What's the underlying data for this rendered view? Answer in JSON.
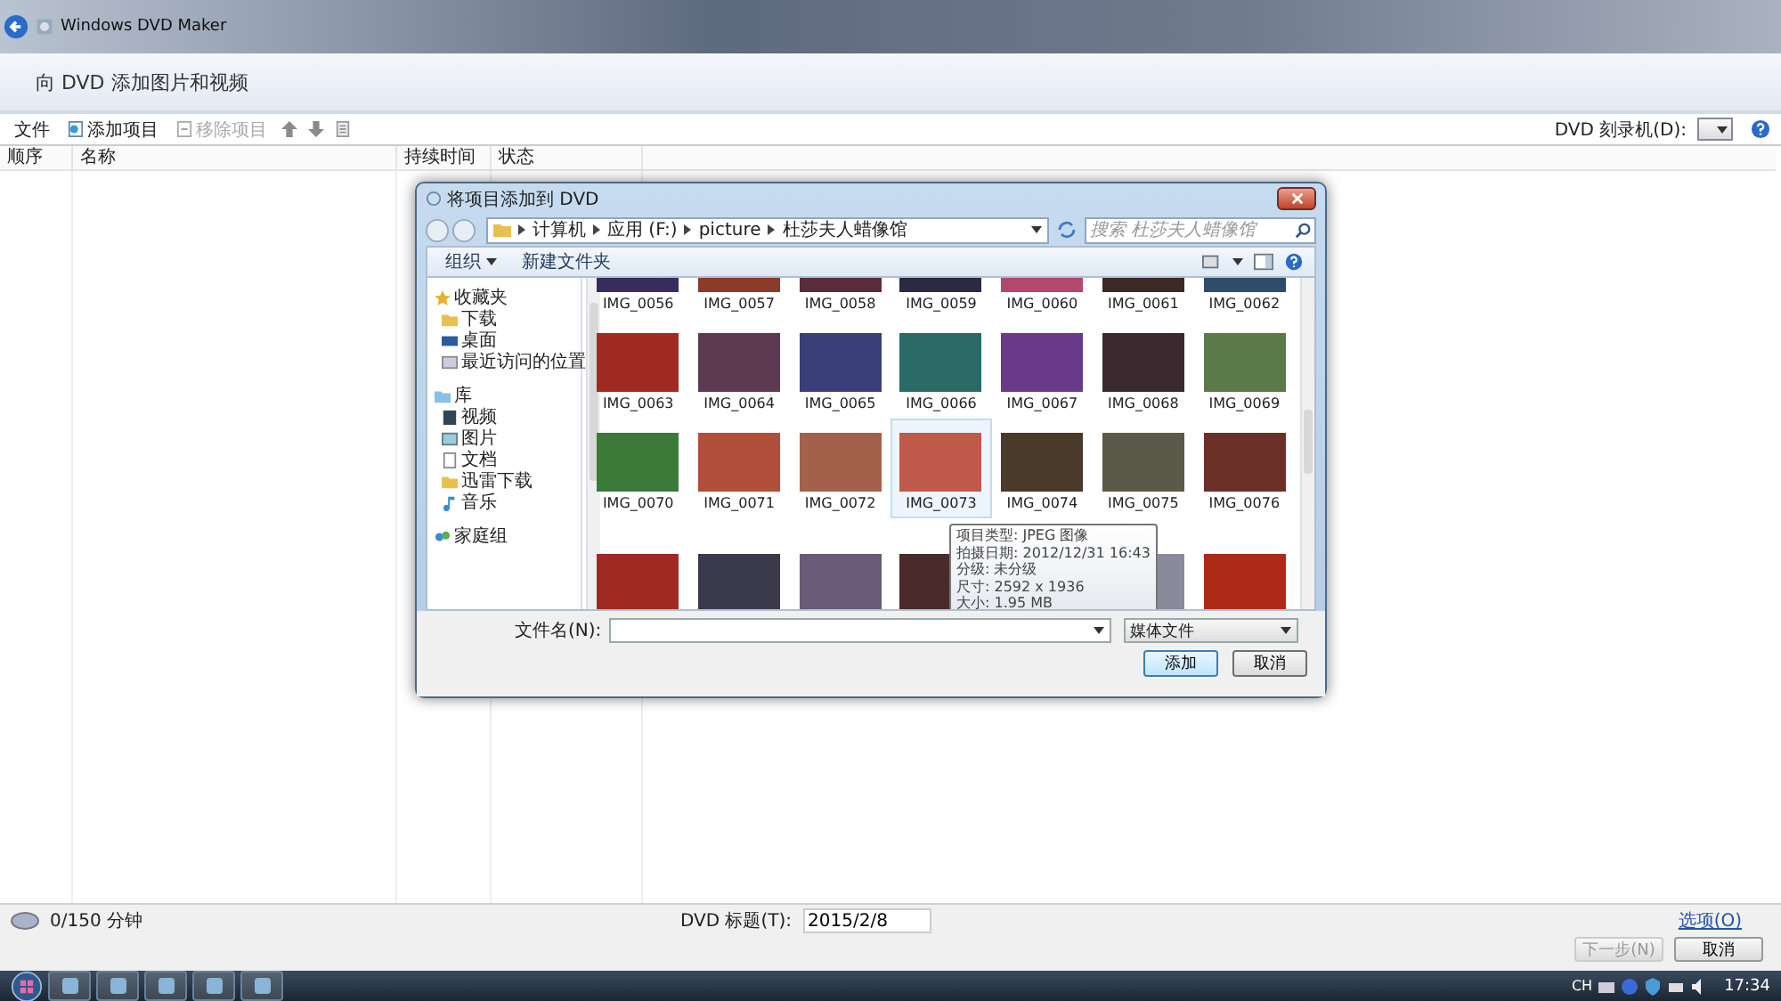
{
  "app": {
    "title": "Windows DVD Maker"
  },
  "header": {
    "title": "向 DVD 添加图片和视频"
  },
  "toolbar": {
    "items": [
      {
        "label": "文件",
        "kind": "menu",
        "disabled": false
      },
      {
        "label": "添加项目",
        "kind": "add",
        "disabled": false
      },
      {
        "label": "移除项目",
        "kind": "remove",
        "disabled": true
      }
    ],
    "burner_label": "DVD 刻录机(D):"
  },
  "list": {
    "columns": [
      "顺序",
      "名称",
      "持续时间",
      "状态"
    ]
  },
  "dialog": {
    "title": "将项目添加到 DVD",
    "breadcrumb": [
      "计算机",
      "应用 (F:)",
      "picture",
      "杜莎夫人蜡像馆"
    ],
    "search": {
      "placeholder": "搜索 杜莎夫人蜡像馆"
    },
    "commands": [
      {
        "label": "组织",
        "dropdown": true
      },
      {
        "label": "新建文件夹",
        "dropdown": false
      }
    ],
    "nav": [
      {
        "label": "收藏夹",
        "kind": "favorites",
        "items": [
          {
            "label": "下载",
            "kind": "download"
          },
          {
            "label": "桌面",
            "kind": "desktop"
          },
          {
            "label": "最近访问的位置",
            "kind": "recent"
          }
        ]
      },
      {
        "label": "库",
        "kind": "library",
        "items": [
          {
            "label": "视频",
            "kind": "video"
          },
          {
            "label": "图片",
            "kind": "pictures"
          },
          {
            "label": "文档",
            "kind": "docs"
          },
          {
            "label": "迅雷下载",
            "kind": "download"
          },
          {
            "label": "音乐",
            "kind": "music"
          }
        ]
      },
      {
        "label": "家庭组",
        "kind": "homegroup"
      }
    ],
    "files": [
      {
        "name": "IMG_0056",
        "selected": false
      },
      {
        "name": "IMG_0057",
        "selected": false
      },
      {
        "name": "IMG_0058",
        "selected": false
      },
      {
        "name": "IMG_0059",
        "selected": false
      },
      {
        "name": "IMG_0060",
        "selected": false
      },
      {
        "name": "IMG_0061",
        "selected": false
      },
      {
        "name": "IMG_0062",
        "selected": false
      },
      {
        "name": "IMG_0063",
        "selected": false
      },
      {
        "name": "IMG_0064",
        "selected": false
      },
      {
        "name": "IMG_0065",
        "selected": false
      },
      {
        "name": "IMG_0066",
        "selected": false
      },
      {
        "name": "IMG_0067",
        "selected": false
      },
      {
        "name": "IMG_0068",
        "selected": false
      },
      {
        "name": "IMG_0069",
        "selected": false
      },
      {
        "name": "IMG_0070",
        "selected": false
      },
      {
        "name": "IMG_0071",
        "selected": false
      },
      {
        "name": "IMG_0072",
        "selected": false
      },
      {
        "name": "IMG_0073",
        "selected": true
      },
      {
        "name": "IMG_0074",
        "selected": false
      },
      {
        "name": "IMG_0075",
        "selected": false
      },
      {
        "name": "IMG_0076",
        "selected": false
      }
    ],
    "tooltip": [
      "项目类型: JPEG 图像",
      "拍摄日期: 2012/12/31 16:43",
      "分级: 未分级",
      "尺寸: 2592 x 1936",
      "大小: 1.95 MB"
    ],
    "filename_label": "文件名(N):",
    "filter": "媒体文件",
    "buttons": [
      {
        "label": "添加",
        "default": true
      },
      {
        "label": "取消",
        "default": false
      }
    ]
  },
  "footer": {
    "duration": "0/150 分钟",
    "title_label": "DVD 标题(T):",
    "title_value": "2015/2/8",
    "options_link": "选项(O)",
    "buttons": [
      {
        "label": "下一步(N)",
        "disabled": true
      },
      {
        "label": "取消",
        "disabled": false
      }
    ]
  },
  "taskbar": {
    "language": "CH",
    "time": "17:34"
  }
}
